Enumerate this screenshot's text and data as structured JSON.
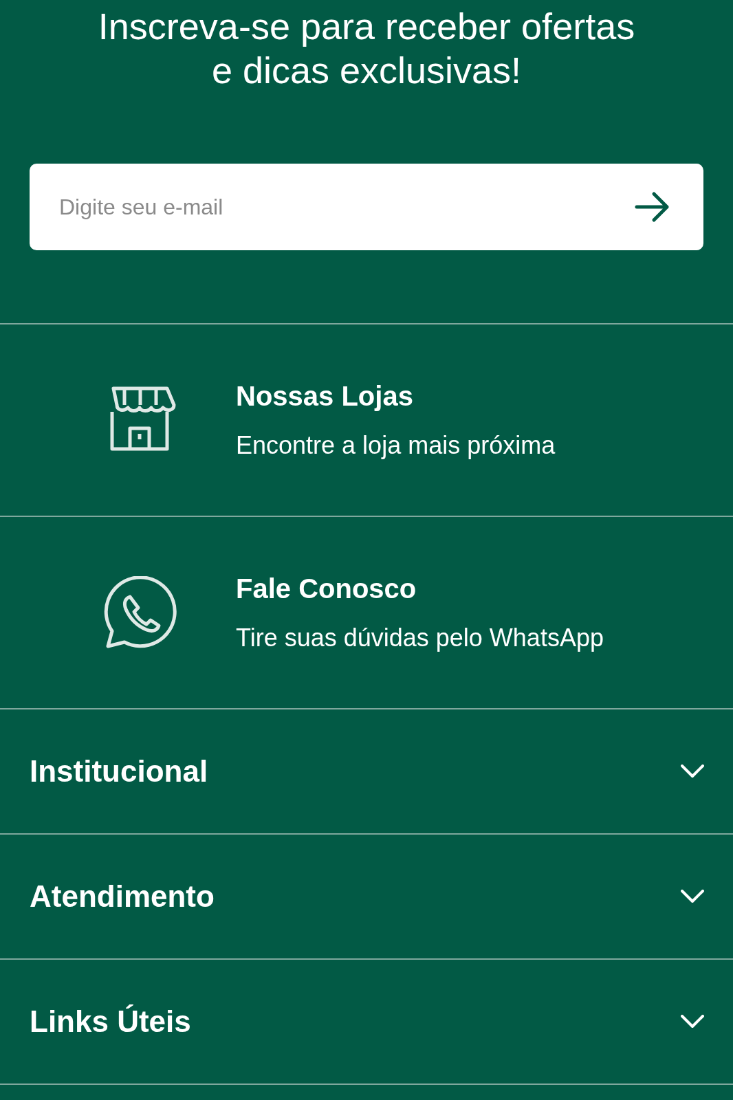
{
  "newsletter": {
    "title": "Inscreva-se para receber ofertas e dicas exclusivas!",
    "email_field": {
      "placeholder": "Digite seu e-mail"
    }
  },
  "contact_cards": [
    {
      "kind": "store",
      "title": "Nossas Lojas",
      "subtitle": "Encontre a loja mais próxima"
    },
    {
      "kind": "whatsapp",
      "title": "Fale Conosco",
      "subtitle": "Tire suas dúvidas pelo WhatsApp"
    }
  ],
  "accordion": [
    {
      "label": "Institucional",
      "expanded": false
    },
    {
      "label": "Atendimento",
      "expanded": false
    },
    {
      "label": "Links Úteis",
      "expanded": false
    }
  ]
}
